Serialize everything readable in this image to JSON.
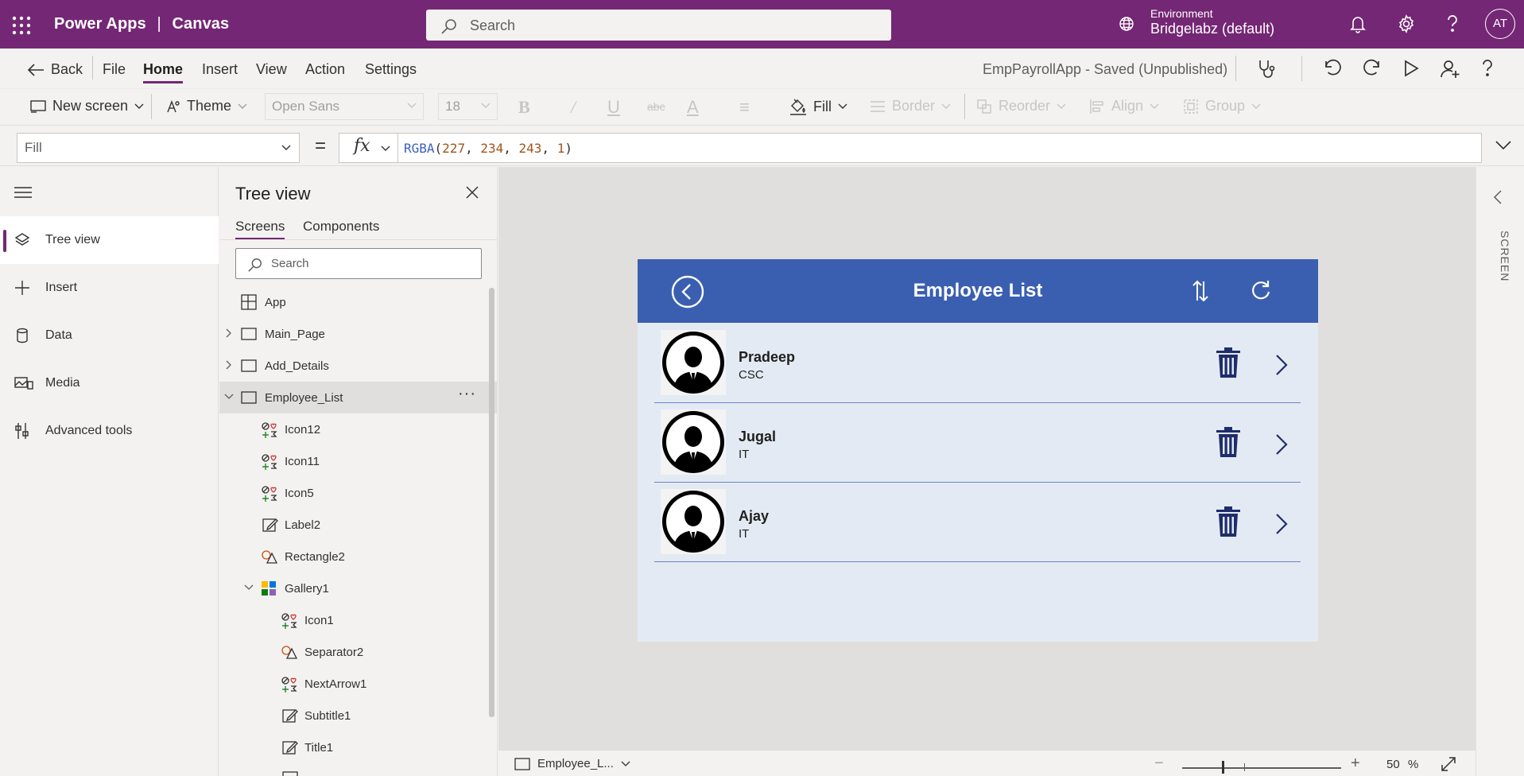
{
  "topbar": {
    "app_name": "Power Apps",
    "separator": "|",
    "app_type": "Canvas",
    "search_placeholder": "Search",
    "environment_label": "Environment",
    "environment_value": "Bridgelabz (default)",
    "avatar_initials": "AT",
    "bg_color": "#742774"
  },
  "menu": {
    "back": "Back",
    "items": [
      "File",
      "Home",
      "Insert",
      "View",
      "Action",
      "Settings"
    ],
    "active": "Home",
    "save_status": "EmpPayrollApp - Saved (Unpublished)"
  },
  "toolbar": {
    "new_screen": "New screen",
    "theme": "Theme",
    "font": "Open Sans",
    "font_size": "18",
    "fill": "Fill",
    "border": "Border",
    "reorder": "Reorder",
    "align": "Align",
    "group": "Group"
  },
  "formula": {
    "property": "Fill",
    "equals": "=",
    "fx": "fx",
    "fn": "RGBA",
    "open": "(",
    "args": [
      "227",
      "234",
      "243",
      "1"
    ],
    "sep": ", ",
    "close": ")"
  },
  "leftnav": {
    "items": [
      "Tree view",
      "Insert",
      "Data",
      "Media",
      "Advanced tools"
    ],
    "active": "Tree view"
  },
  "treeview": {
    "title": "Tree view",
    "tabs": [
      "Screens",
      "Components"
    ],
    "active_tab": "Screens",
    "search_placeholder": "Search",
    "nodes": [
      {
        "label": "App"
      },
      {
        "label": "Main_Page"
      },
      {
        "label": "Add_Details"
      },
      {
        "label": "Employee_List",
        "selected": true,
        "more": "···"
      },
      {
        "label": "Icon12"
      },
      {
        "label": "Icon11"
      },
      {
        "label": "Icon5"
      },
      {
        "label": "Label2"
      },
      {
        "label": "Rectangle2"
      },
      {
        "label": "Gallery1"
      },
      {
        "label": "Icon1"
      },
      {
        "label": "Separator2"
      },
      {
        "label": "NextArrow1"
      },
      {
        "label": "Subtitle1"
      },
      {
        "label": "Title1"
      }
    ]
  },
  "app_screen": {
    "title": "Employee List",
    "header_color": "#3b5fb0",
    "background_color": "#e3eaf3",
    "employees": [
      {
        "name": "Pradeep",
        "department": "CSC"
      },
      {
        "name": "Jugal",
        "department": "IT"
      },
      {
        "name": "Ajay",
        "department": "IT"
      }
    ]
  },
  "rightpanel": {
    "label": "SCREEN"
  },
  "statusbar": {
    "screen_name": "Employee_L...",
    "zoom_minus": "−",
    "zoom_plus": "+",
    "zoom_value": "50",
    "zoom_unit": "%"
  }
}
